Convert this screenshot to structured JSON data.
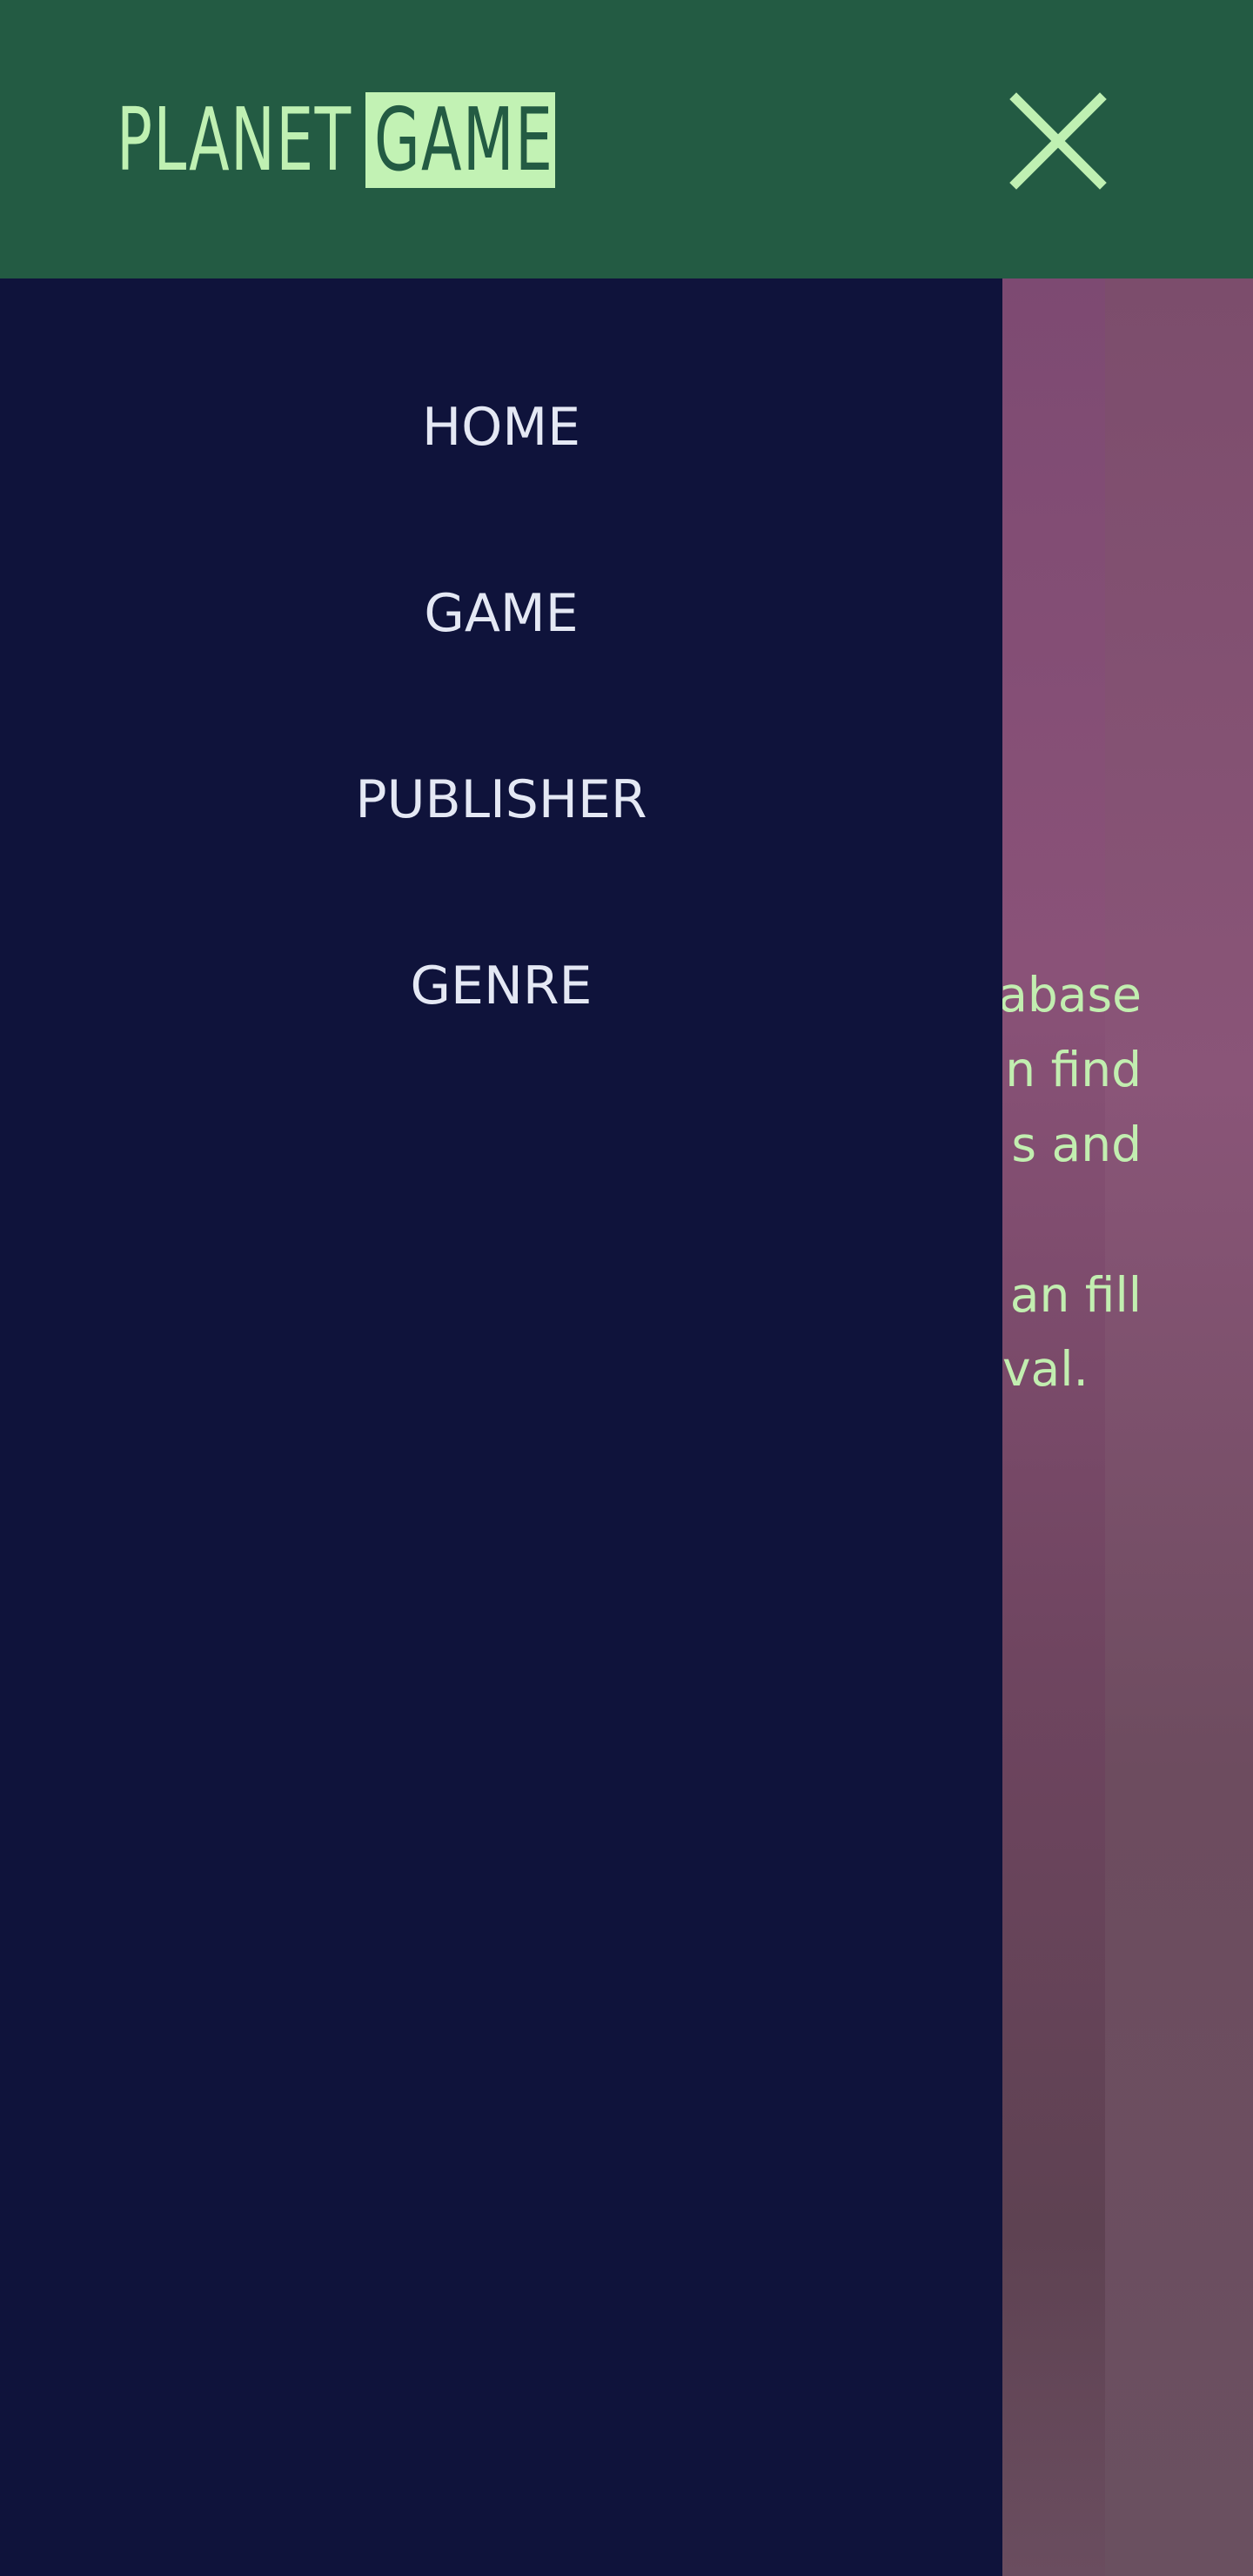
{
  "header": {
    "logo_part_1": "PLANET",
    "logo_part_2": "GAME",
    "close_icon": "close-icon"
  },
  "nav": {
    "items": [
      {
        "label": "HOME"
      },
      {
        "label": "GAME"
      },
      {
        "label": "PUBLISHER"
      },
      {
        "label": "GENRE"
      }
    ]
  },
  "background": {
    "intro_lines": [
      "abase",
      "n find",
      "s and",
      "an fill",
      "val."
    ]
  },
  "colors": {
    "header_bg": "#235b43",
    "accent_green": "#bff0b2",
    "drawer_bg": "#0f133b",
    "nav_text": "#e4e8f4"
  }
}
